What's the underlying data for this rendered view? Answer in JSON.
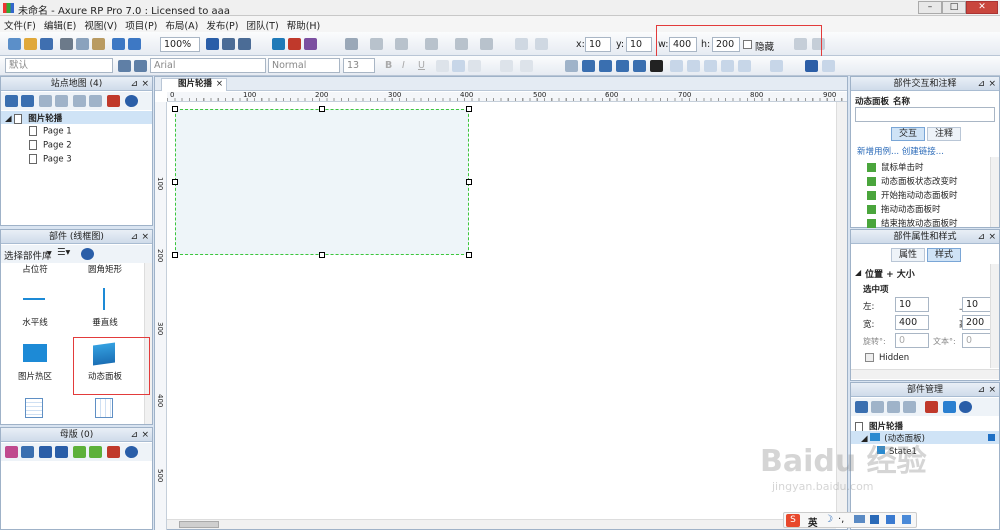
{
  "window": {
    "title": "未命名 - Axure RP Pro 7.0 : Licensed to aaa"
  },
  "menu": [
    "文件(F)",
    "编辑(E)",
    "视图(V)",
    "项目(P)",
    "布局(A)",
    "发布(P)",
    "团队(T)",
    "帮助(H)"
  ],
  "toolbar": {
    "zoom": "100%",
    "x_label": "x:",
    "x_value": "10",
    "y_label": "y:",
    "y_value": "10",
    "w_label": "w:",
    "w_value": "400",
    "h_label": "h:",
    "h_value": "200",
    "hidden_label": "隐藏",
    "style_default": "默认",
    "font": "Arial",
    "font_style": "Normal",
    "font_size": "13"
  },
  "sitemap": {
    "title": "站点地图 (4)",
    "root": "图片轮播",
    "pages": [
      "Page 1",
      "Page 2",
      "Page 3"
    ]
  },
  "widgets": {
    "title": "部件 (线框图)",
    "library": "选择部件库",
    "top_labels": [
      "占位符",
      "圆角矩形"
    ],
    "items": [
      "水平线",
      "垂直线",
      "图片热区",
      "动态面板"
    ]
  },
  "masters": {
    "title": "母版 (0)"
  },
  "canvas": {
    "tab": "图片轮播",
    "ruler_h": [
      "0",
      "100",
      "200",
      "300",
      "400",
      "500",
      "600",
      "700",
      "800",
      "900"
    ],
    "ruler_v": [
      "100",
      "200",
      "300",
      "400",
      "500"
    ]
  },
  "interactions": {
    "title": "部件交互和注释",
    "name_label": "动态面板",
    "name_field": "名称",
    "tabs": [
      "交互",
      "注释"
    ],
    "links": "新增用例... 创建链接...",
    "events": [
      "鼠标单击时",
      "动态面板状态改变时",
      "开始拖动动态面板时",
      "拖动动态面板时",
      "结束拖放动态面板时"
    ]
  },
  "properties": {
    "title": "部件属性和样式",
    "tabs": [
      "属性",
      "样式"
    ],
    "section": "位置 + 大小",
    "selected": "选中项",
    "left_label": "左:",
    "left": "10",
    "top_label": "上:",
    "top": "10",
    "width_label": "宽:",
    "width": "400",
    "height_label": "高:",
    "height": "200",
    "rotate_label": "旋转°:",
    "rotate": "0",
    "text_label": "文本°:",
    "text": "0",
    "hidden": "Hidden"
  },
  "widget_manager": {
    "title": "部件管理",
    "root": "图片轮播",
    "panel": "(动态面板)",
    "state": "State1"
  },
  "watermark": {
    "brand": "Baidu 经验",
    "url": "jingyan.baidu.com"
  },
  "ime": {
    "label": "英"
  }
}
